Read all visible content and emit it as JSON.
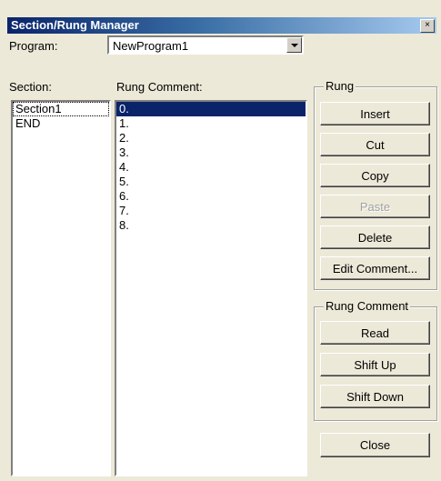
{
  "window": {
    "title": "Section/Rung Manager",
    "close_glyph": "×"
  },
  "program": {
    "label": "Program:",
    "value": "NewProgram1"
  },
  "section": {
    "label": "Section:",
    "items": [
      "Section1",
      "END"
    ],
    "selected_index": 0
  },
  "rung_comment_list": {
    "label": "Rung Comment:",
    "items": [
      "0.",
      "1.",
      "2.",
      "3.",
      "4.",
      "5.",
      "6.",
      "7.",
      "8."
    ],
    "selected_index": 0
  },
  "rung_group": {
    "title": "Rung",
    "buttons": [
      "Insert",
      "Cut",
      "Copy",
      "Paste",
      "Delete",
      "Edit Comment..."
    ],
    "disabled": [
      "Paste"
    ]
  },
  "rung_comment_group": {
    "title": "Rung Comment",
    "buttons": [
      "Read",
      "Shift Up",
      "Shift Down"
    ]
  },
  "close_button": "Close",
  "colors": {
    "face": "#ece9d8",
    "selection": "#0a246a",
    "title_start": "#0a246a",
    "title_end": "#a6caf0"
  }
}
